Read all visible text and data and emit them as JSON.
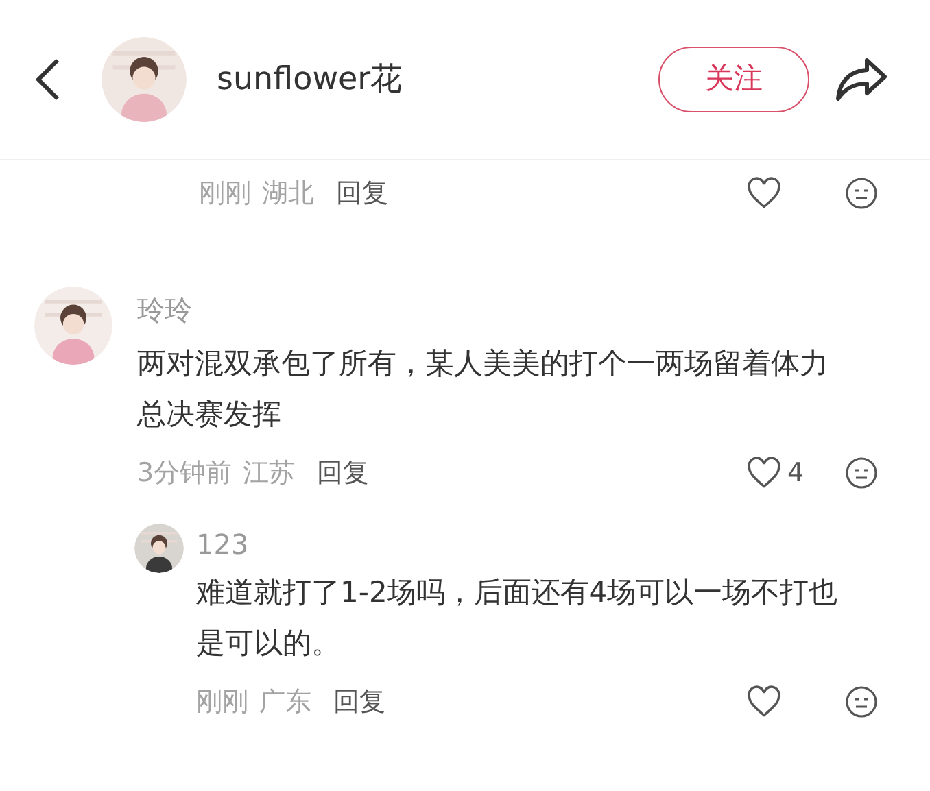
{
  "header": {
    "username": "sunflower花",
    "follow_button": "关注"
  },
  "partial_comment": {
    "time": "刚刚",
    "location": "湖北",
    "reply_label": "回复"
  },
  "comments": [
    {
      "author": "玲玲",
      "text": "两对混双承包了所有，某人美美的打个一两场留着体力总决赛发挥",
      "time": "3分钟前",
      "location": "江苏",
      "reply_label": "回复",
      "likes": "4",
      "replies": [
        {
          "author": "123",
          "text": "难道就打了1-2场吗，后面还有4场可以一场不打也是可以的。",
          "time": "刚刚",
          "location": "广东",
          "reply_label": "回复"
        }
      ]
    }
  ]
}
